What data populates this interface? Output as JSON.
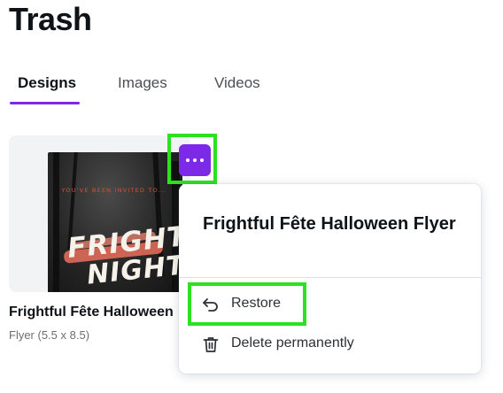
{
  "page": {
    "title": "Trash"
  },
  "tabs": [
    {
      "label": "Designs",
      "active": true
    },
    {
      "label": "Images",
      "active": false
    },
    {
      "label": "Videos",
      "active": false
    }
  ],
  "design_card": {
    "title": "Frightful Fête Halloween Flyer",
    "subtitle": "Flyer (5.5 x 8.5)",
    "thumbnail": {
      "invite_text": "YOU'VE BEEN INVITED TO...",
      "headline_1": "FRIGHT",
      "headline_2": "NIGHT"
    }
  },
  "more_button": {
    "icon": "more-horizontal-icon"
  },
  "context_menu": {
    "title": "Frightful Fête Halloween Flyer",
    "items": [
      {
        "label": "Restore",
        "icon": "undo-arrow-icon"
      },
      {
        "label": "Delete permanently",
        "icon": "trash-icon"
      }
    ]
  },
  "colors": {
    "accent": "#7d2ae8",
    "highlight": "#2ce11f"
  }
}
